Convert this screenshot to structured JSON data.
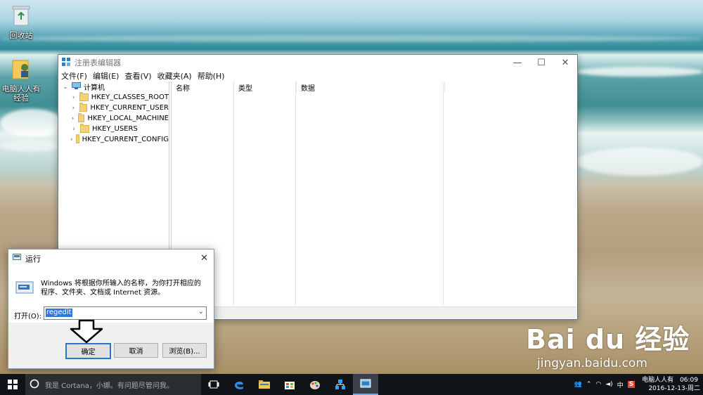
{
  "desktop": {
    "icons": [
      {
        "label": "回收站",
        "icon": "recycle-bin-icon"
      },
      {
        "label": "电脑人人有经验",
        "icon": "user-folder-icon"
      }
    ]
  },
  "regedit": {
    "title": "注册表编辑器",
    "controls": {
      "minimize": "—",
      "maximize": "☐",
      "close": "✕"
    },
    "menu": [
      "文件(F)",
      "编辑(E)",
      "查看(V)",
      "收藏夹(A)",
      "帮助(H)"
    ],
    "tree": {
      "root": "计算机",
      "keys": [
        "HKEY_CLASSES_ROOT",
        "HKEY_CURRENT_USER",
        "HKEY_LOCAL_MACHINE",
        "HKEY_USERS",
        "HKEY_CURRENT_CONFIG"
      ]
    },
    "columns": [
      "名称",
      "类型",
      "数据"
    ]
  },
  "run": {
    "title": "运行",
    "description": "Windows 将根据你所输入的名称，为你打开相应的程序、文件夹、文档或 Internet 资源。",
    "open_label": "打开(O):",
    "input_value": "regedit",
    "ok": "确定",
    "cancel": "取消",
    "browse": "浏览(B)..."
  },
  "watermark": {
    "text": "Bai du 经验",
    "url": "jingyan.baidu.com"
  },
  "taskbar": {
    "search_placeholder": "我是 Cortana，小娜。有问题尽管问我。",
    "tray": {
      "ime": "中",
      "user": "电脑人人有",
      "time": "06:09",
      "date": "2016-12-13-周二"
    }
  },
  "colors": {
    "accent": "#3378d7",
    "taskbar": "#101418"
  }
}
